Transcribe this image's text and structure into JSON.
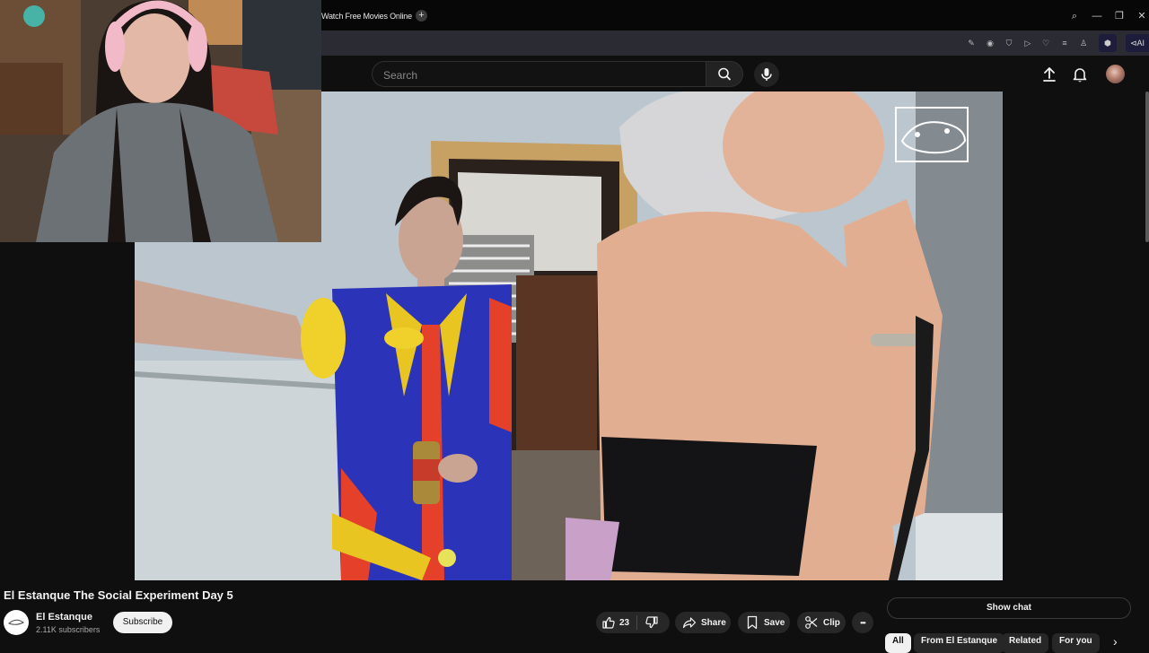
{
  "browser": {
    "tab_title": "Watch Free Movies Online",
    "new_tab_glyph": "+",
    "window_controls": {
      "search": "⌕",
      "minimize": "—",
      "restore": "❐",
      "close": "✕"
    },
    "extensions": [
      "✎",
      "◉",
      "⛉",
      "▷",
      "♡",
      "≡",
      "♙"
    ],
    "ai_label": "⊲AI"
  },
  "header": {
    "search": {
      "placeholder": "Search",
      "value": ""
    }
  },
  "video": {
    "title": "El Estanque The Social Experiment Day 5",
    "channel": {
      "name": "El Estanque",
      "subscribers": "2.11K subscribers"
    },
    "subscribe_label": "Subscribe",
    "actions": {
      "like_count": "23",
      "share_label": "Share",
      "save_label": "Save",
      "clip_label": "Clip",
      "more_label": "•••"
    }
  },
  "sidebar": {
    "show_chat_label": "Show chat",
    "chips": [
      {
        "label": "All",
        "active": true
      },
      {
        "label": "From El Estanque",
        "active": false
      },
      {
        "label": "Related",
        "active": false
      },
      {
        "label": "For you",
        "active": false
      }
    ],
    "chips_next": "›"
  },
  "colors": {
    "page_bg": "#0f0f0f",
    "chrome_bg": "#070707",
    "address_bar_bg": "#2b2c33",
    "pill_bg": "#272727",
    "text": "#f1f1f1"
  },
  "icons": [
    "search-icon",
    "microphone-icon",
    "upload-icon",
    "bell-icon",
    "like-icon",
    "dislike-icon",
    "share-icon",
    "save-icon",
    "clip-icon",
    "more-icon",
    "chevron-right-icon"
  ]
}
